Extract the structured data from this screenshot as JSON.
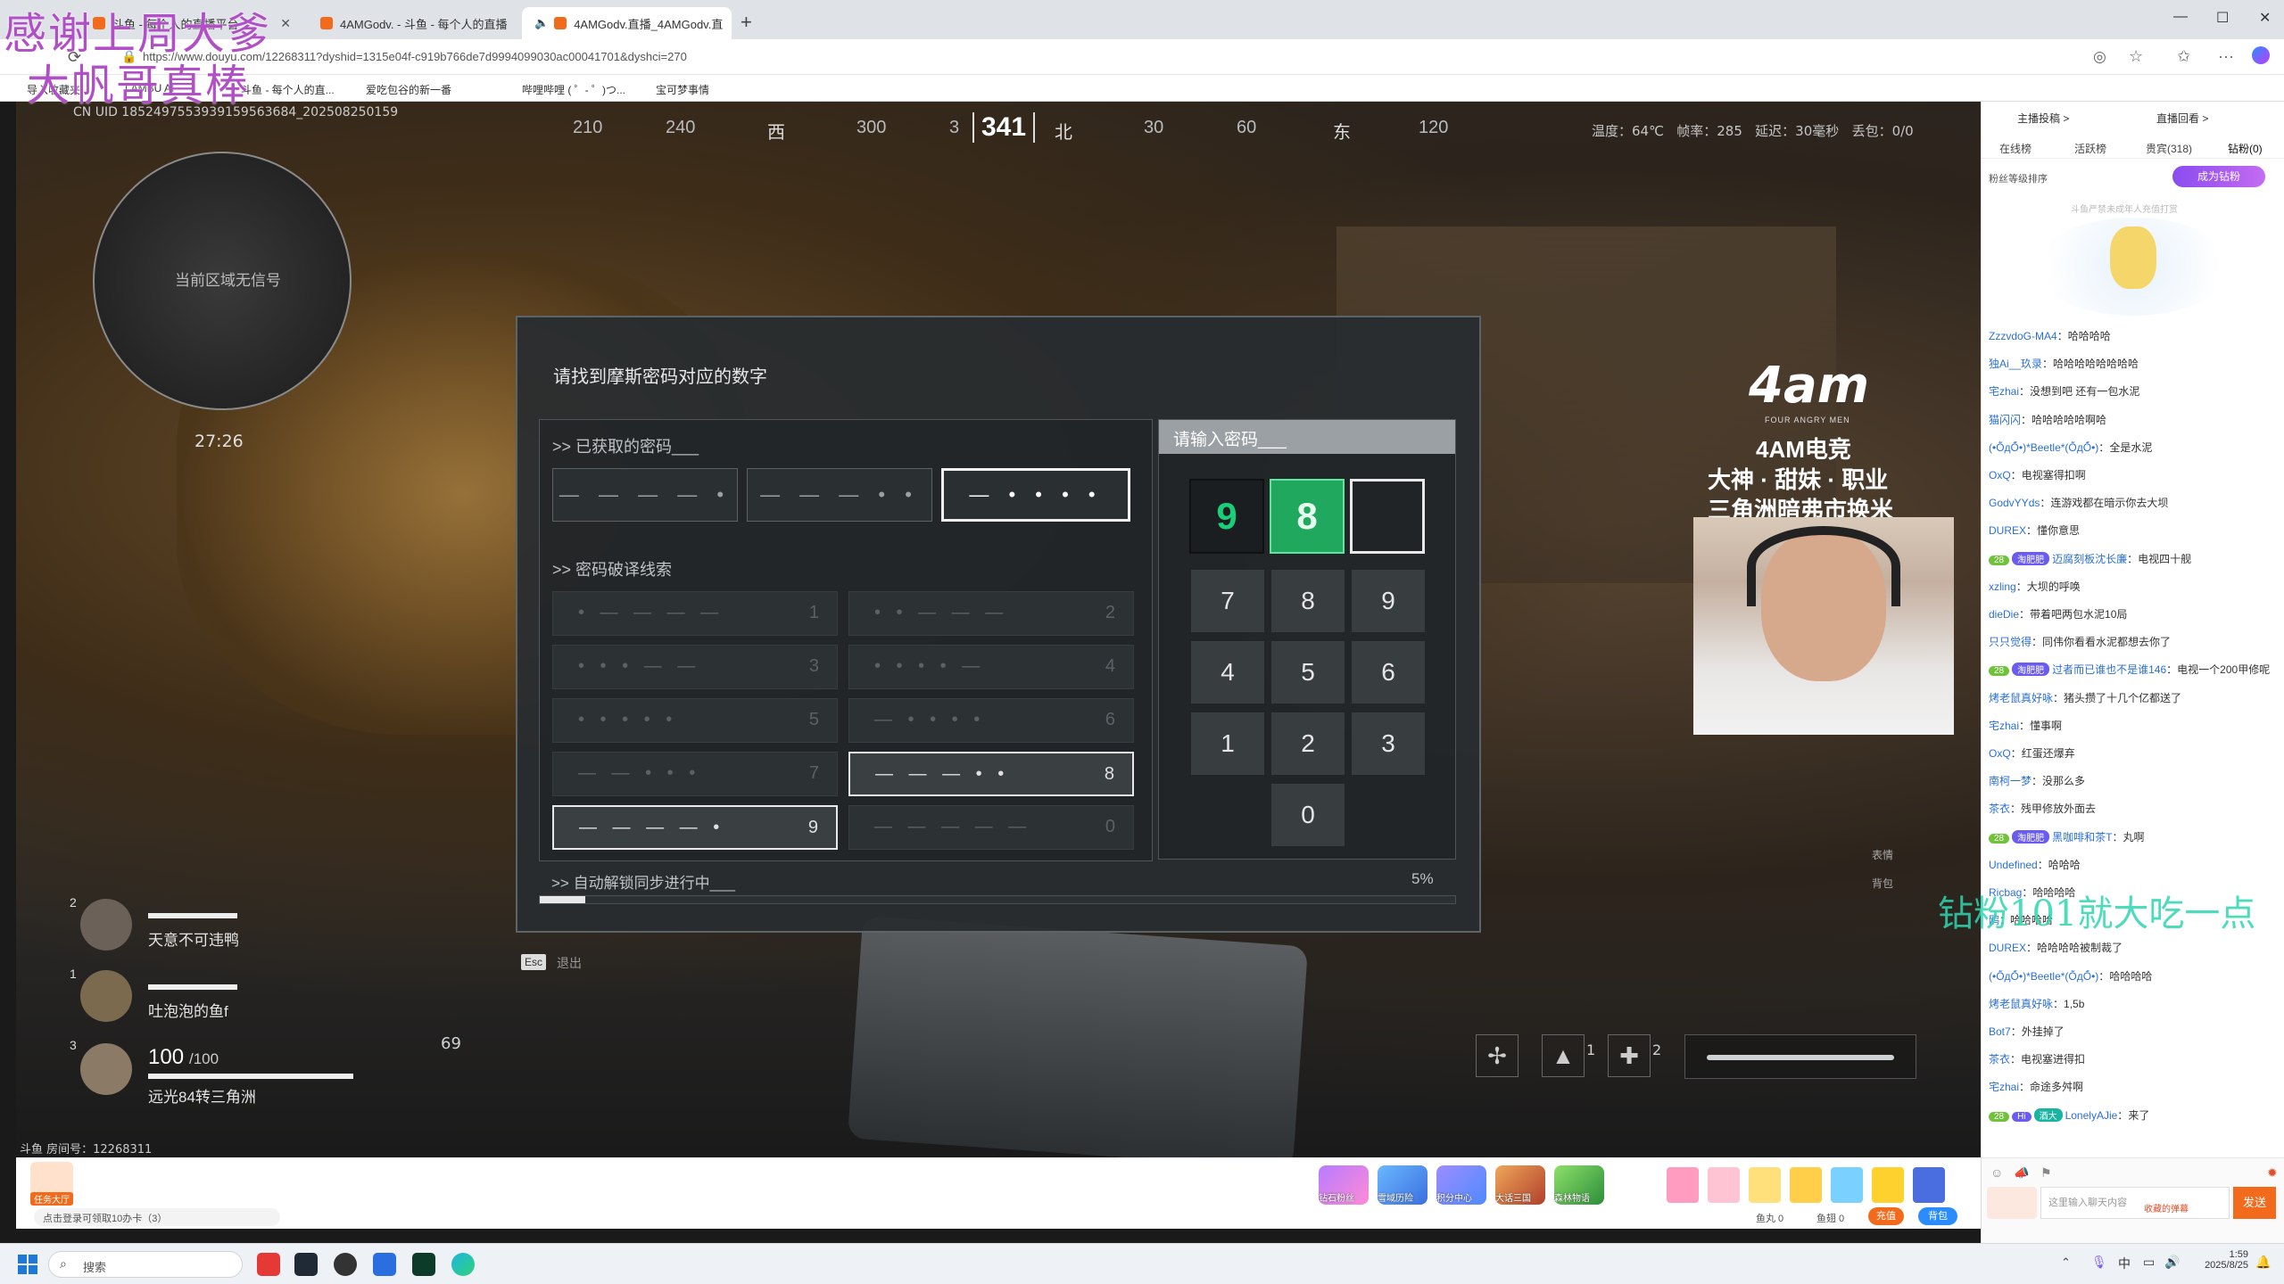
{
  "browser": {
    "tabs": [
      {
        "label": "斗鱼 - 每个人的直播平台"
      },
      {
        "label": "4AMGodv. - 斗鱼 - 每个人的直播"
      },
      {
        "label": "4AMGodv.直播_4AMGodv.直"
      }
    ],
    "url": "https://www.douyu.com/12268311?dyshid=1315e04f-c919b766de7d9994099030ac00041701&dyshci=270",
    "bookmarks": [
      "导入收藏夹",
      "LAMBU AI",
      "斗鱼 - 每个人的直...",
      "爱吃包谷的新一番",
      "哔哩哔哩 ( ゜- ゜)つ...",
      "宝可梦事情"
    ]
  },
  "overlay": {
    "line1": "感谢上周大爹",
    "line2": "大帆哥真棒",
    "side_text": "钻粉101就大吃一点"
  },
  "hud": {
    "uid": "CN UID 1852497553939159563684_202508250159",
    "compass": [
      "210",
      "240",
      "西",
      "300",
      "3",
      "341",
      "北",
      "30",
      "60",
      "东",
      "120"
    ],
    "stats": "温度：64℃   帧率：285   延迟：30毫秒   丢包：0/0",
    "radar_text": "当前区域无信号",
    "timer": "27:26",
    "teammates": [
      {
        "index": "2",
        "name": "天意不可违鸭"
      },
      {
        "index": "1",
        "name": "吐泡泡的鱼f"
      },
      {
        "index": "3",
        "hp": "100",
        "hp_max": "/100",
        "name": "远光84转三角洲"
      }
    ],
    "ammo": "69",
    "room_no": "斗鱼 房间号：12268311",
    "esc": "Esc",
    "esc_label": "退出",
    "weapon_slots": [
      "1",
      "2"
    ],
    "keys_bottom": [
      "表情",
      "背包"
    ]
  },
  "puzzle": {
    "title": "请找到摩斯密码对应的数字",
    "obtained_label": ">> 已获取的密码___",
    "codes": [
      "— — — — •",
      "— — — • •",
      "— • • • •"
    ],
    "clues_label": ">> 密码破译线索",
    "clues": [
      {
        "pattern": "• — — — —",
        "num": "1"
      },
      {
        "pattern": "• • — — —",
        "num": "2"
      },
      {
        "pattern": "• • • — —",
        "num": "3"
      },
      {
        "pattern": "• • • • —",
        "num": "4"
      },
      {
        "pattern": "• • • • •",
        "num": "5"
      },
      {
        "pattern": "— • • • •",
        "num": "6"
      },
      {
        "pattern": "— — • • •",
        "num": "7"
      },
      {
        "pattern": "— — — • •",
        "num": "8"
      },
      {
        "pattern": "— — — — •",
        "num": "9"
      },
      {
        "pattern": "— — — — —",
        "num": "0"
      }
    ],
    "input_label": "请输入密码___",
    "slots": [
      "9",
      "8",
      ""
    ],
    "keypad": [
      "7",
      "8",
      "9",
      "4",
      "5",
      "6",
      "1",
      "2",
      "3",
      "0"
    ],
    "sync_label": ">> 自动解锁同步进行中___",
    "progress_text": "5%",
    "progress": 0.05
  },
  "streamer": {
    "logo": "4am",
    "logo_sub": "FOUR ANGRY MEN",
    "title": "4AM电竞",
    "slogan1": "大神 · 甜妹 · 职业",
    "slogan2": "三角洲暗弗市换米"
  },
  "sidebar": {
    "top_links": [
      "主播投稿 >",
      "直播回看 >"
    ],
    "tabs": [
      "在线榜",
      "活跃榜",
      "贵宾(318)",
      "钻粉(0)"
    ],
    "fan_sort": "粉丝等级排序",
    "fan_btn": "成为钻粉",
    "fan_tip": "斗鱼严禁未成年人充值打赏",
    "chat": [
      {
        "user": "ZzzvdoG-MA4",
        "msg": "哈哈哈哈"
      },
      {
        "user": "独Ai__玖录",
        "msg": "哈哈哈哈哈哈哈哈"
      },
      {
        "user": "宅zhai",
        "msg": "没想到吧 还有一包水泥"
      },
      {
        "user": "猫闪闪",
        "msg": "哈哈哈哈哈啊哈"
      },
      {
        "user": "(•Ő̀дŐ́•)*Beetle*(Ő̀дŐ́•)",
        "msg": "全是水泥"
      },
      {
        "user": "OxQ",
        "msg": "电视塞得扣啊"
      },
      {
        "user": "GodvYYds",
        "msg": "连游戏都在暗示你去大坝"
      },
      {
        "user": "DUREX",
        "msg": "懂你意思"
      },
      {
        "badge": "28",
        "badge2": "淘肥肥",
        "user": "迈腐刻板沈长廉",
        "msg": "电视四十舰"
      },
      {
        "user": "xzling",
        "msg": "大坝的呼唤"
      },
      {
        "user": "dieDie",
        "msg": "带着吧两包水泥10局"
      },
      {
        "user": "只只觉得",
        "msg": "同伟你看看水泥都想去你了"
      },
      {
        "badge": "28",
        "badge2": "淘肥肥",
        "user": "过者而已谁也不是谁146",
        "msg": "电视一个200甲修呢"
      },
      {
        "user": "烤老鼠真好咏",
        "msg": "猪头攒了十几个亿都送了"
      },
      {
        "user": "宅zhai",
        "msg": "懂事啊"
      },
      {
        "user": "OxQ",
        "msg": "红蛋还爆弃"
      },
      {
        "user": "南柯一梦",
        "msg": "没那么多"
      },
      {
        "user": "茶衣",
        "msg": "残甲修放外面去"
      },
      {
        "badge": "28",
        "badge2": "淘肥肥",
        "user": "黑咖啡和茶T",
        "msg": "丸啊"
      },
      {
        "user": "Undefined",
        "msg": "哈哈哈"
      },
      {
        "user": "Ricbag",
        "msg": "哈哈哈哈"
      },
      {
        "user": "鸥",
        "msg": "哈哈哈哈"
      },
      {
        "user": "DUREX",
        "msg": "哈哈哈哈被制裁了"
      },
      {
        "user": "(•Ő̀дŐ́•)*Beetle*(Ő̀дŐ́•)",
        "msg": "哈哈哈哈"
      },
      {
        "user": "烤老鼠真好咏",
        "msg": "1,5b"
      },
      {
        "user": "Bot7",
        "msg": "外挂掉了"
      },
      {
        "user": "茶衣",
        "msg": "电视塞进得扣"
      },
      {
        "user": "宅zhai",
        "msg": "命途多舛啊"
      },
      {
        "badge": "28",
        "badge2": "Hi",
        "badge3": "酒大",
        "user": "LonelyAJie",
        "msg": "来了"
      }
    ],
    "input_placeholder": "这里输入聊天内容",
    "send": "发送",
    "barrage": "收藏的弹幕",
    "fish": "鱼丸 0",
    "fish2": "鱼翅 0",
    "recharge": "充值",
    "bag": "背包"
  },
  "bottom": {
    "task": "任务大厅",
    "login_tip": "点击登录可领取10办卡（3）",
    "games": [
      "钻石粉丝",
      "雪域历险",
      "积分中心",
      "大话三国",
      "森林物语"
    ]
  },
  "taskbar": {
    "search": "搜索",
    "time": "1:59",
    "date": "2025/8/25",
    "ime": "中"
  },
  "colors": {
    "accent": "#f26b1d",
    "green": "#1fa85e",
    "overlay": "#b04fc6"
  }
}
